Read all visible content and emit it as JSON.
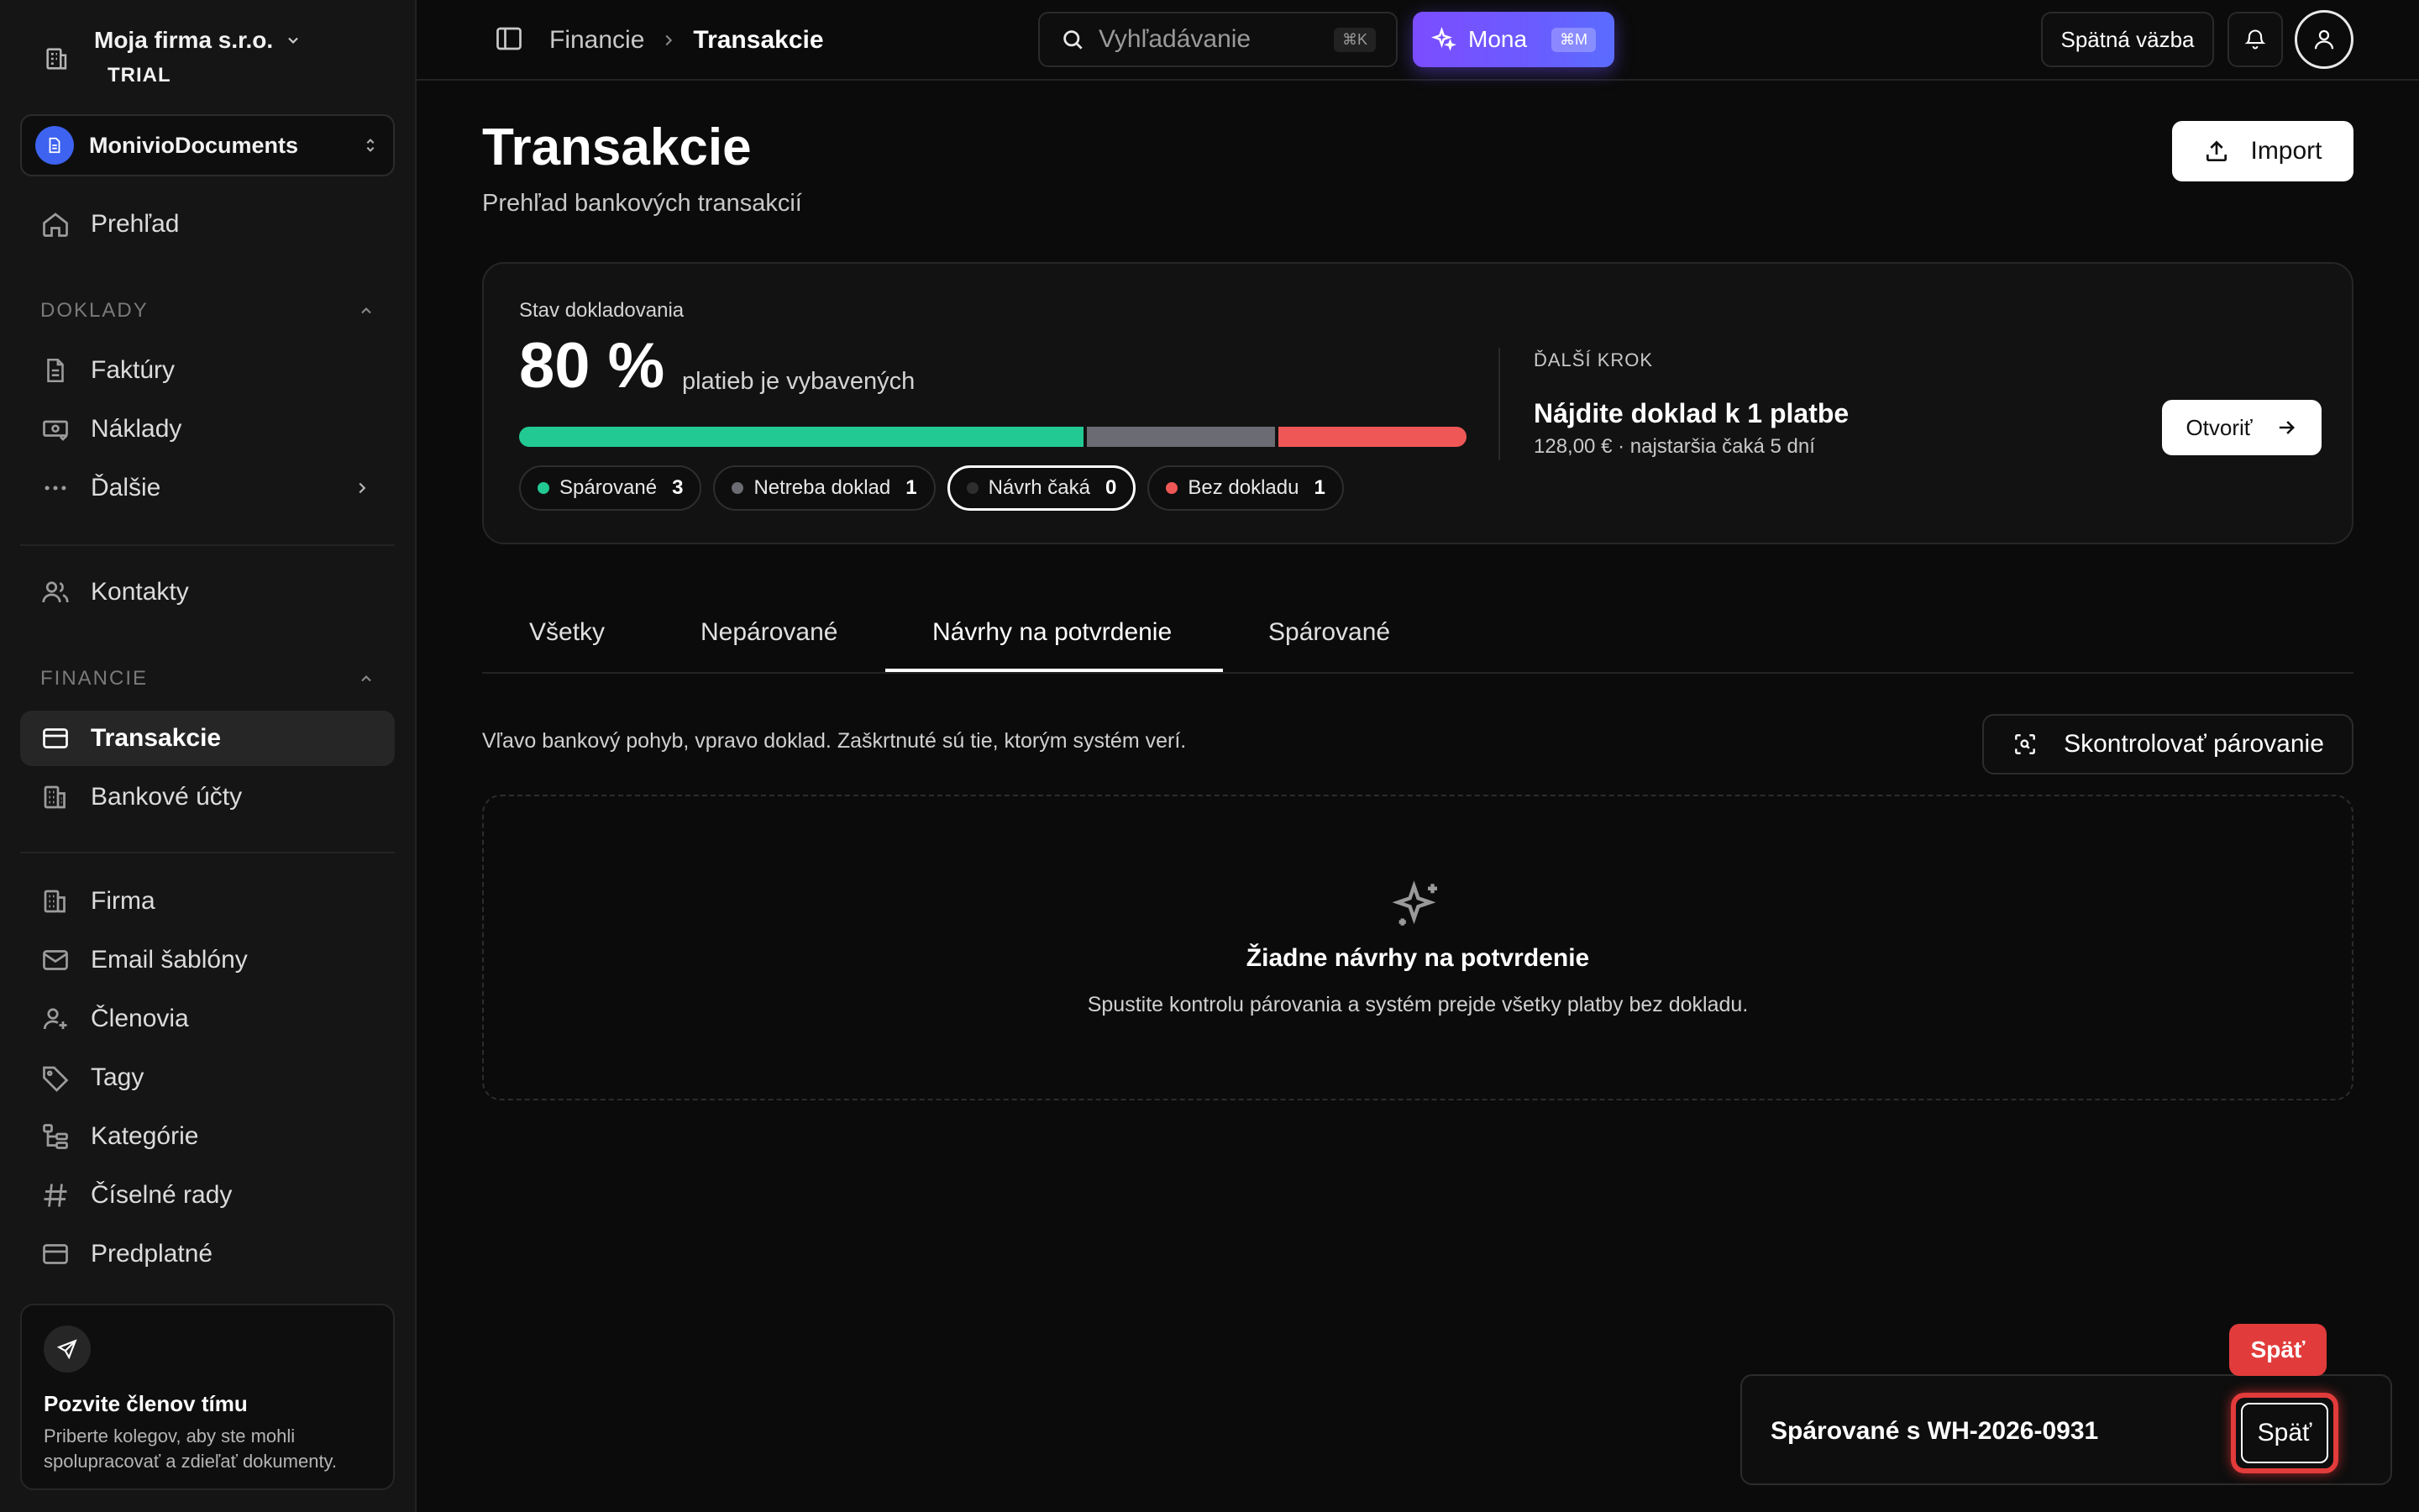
{
  "org": {
    "name": "Moja firma s.r.o.",
    "badge": "TRIAL"
  },
  "workspace": {
    "name": "MonivioDocuments"
  },
  "sidebar": {
    "overview": "Prehľad",
    "section_doklady": "DOKLADY",
    "faktury": "Faktúry",
    "naklady": "Náklady",
    "dalsie": "Ďalšie",
    "kontakty": "Kontakty",
    "section_financie": "FINANCIE",
    "transakcie": "Transakcie",
    "bankove_ucty": "Bankové účty",
    "firma": "Firma",
    "email_sablony": "Email šablóny",
    "clenovia": "Členovia",
    "tagy": "Tagy",
    "kategorie": "Kategórie",
    "ciselne_rady": "Číselné rady",
    "predplatne": "Predplatné"
  },
  "invite": {
    "title": "Pozvite členov tímu",
    "text": "Priberte kolegov, aby ste mohli spolupracovať a zdieľať dokumenty."
  },
  "header": {
    "breadcrumb_parent": "Financie",
    "breadcrumb_current": "Transakcie",
    "search_placeholder": "Vyhľadávanie",
    "search_shortcut": "⌘K",
    "mona_label": "Mona",
    "mona_shortcut": "⌘M",
    "feedback_label": "Spätná väzba"
  },
  "page": {
    "title": "Transakcie",
    "subtitle": "Prehľad bankových transakcií",
    "import_label": "Import"
  },
  "status": {
    "label": "Stav dokladovania",
    "percent": "80 %",
    "percent_text": "platieb je vybavených",
    "bar": [
      {
        "name": "Spárované",
        "value": 3,
        "color": "#22c993"
      },
      {
        "name": "Netreba doklad",
        "value": 1,
        "color": "#6b6b73"
      },
      {
        "name": "Bez dokladu",
        "value": 1,
        "color": "#ef5757"
      }
    ],
    "chips": [
      {
        "label": "Spárované",
        "count": "3",
        "color": "#22c993"
      },
      {
        "label": "Netreba doklad",
        "count": "1",
        "color": "#6b6b73"
      },
      {
        "label": "Návrh čaká",
        "count": "0",
        "color": "#2e2e2e"
      },
      {
        "label": "Bez dokladu",
        "count": "1",
        "color": "#ef5757"
      }
    ],
    "next_label": "ĎALŠÍ KROK",
    "next_title": "Nájdite doklad k 1 platbe",
    "next_sub": "128,00 € · najstaršia čaká 5 dní",
    "open_label": "Otvoriť"
  },
  "tabs": [
    "Všetky",
    "Nepárované",
    "Návrhy na potvrdenie",
    "Spárované"
  ],
  "main": {
    "hint": "Vľavo bankový pohyb, vpravo doklad. Zaškrtnuté sú tie, ktorým systém verí.",
    "check_label": "Skontrolovať párovanie",
    "empty_title": "Žiadne návrhy na potvrdenie",
    "empty_text": "Spustite kontrolu párovania a systém prejde všetky platby bez dokladu."
  },
  "toast": {
    "text": "Spárované s WH-2026-0931",
    "button": "Späť",
    "tooltip": "Späť"
  }
}
